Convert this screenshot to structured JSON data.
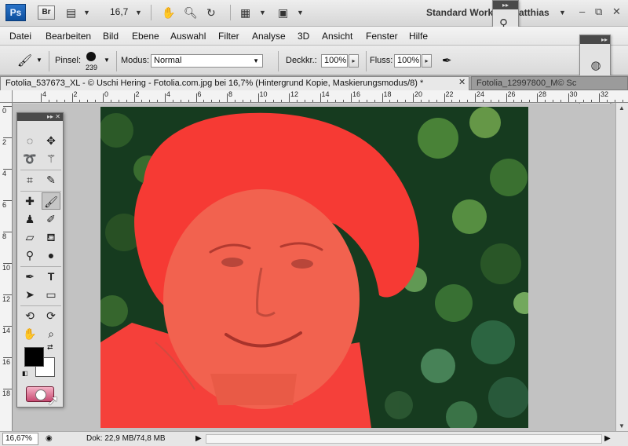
{
  "appbar": {
    "ps": "Ps",
    "br": "Br",
    "zoom": "16,7",
    "workspace": "Standard Work",
    "user": "atthias",
    "minimize": "–",
    "restore": "⧉",
    "close": "✕"
  },
  "menu": [
    "Datei",
    "Bearbeiten",
    "Bild",
    "Ebene",
    "Auswahl",
    "Filter",
    "Analyse",
    "3D",
    "Ansicht",
    "Fenster",
    "Hilfe"
  ],
  "options": {
    "brush_label": "Pinsel:",
    "brush_size": "239",
    "mode_label": "Modus:",
    "mode_value": "Normal",
    "opacity_label": "Deckkr.:",
    "opacity_value": "100%",
    "flow_label": "Fluss:",
    "flow_value": "100%"
  },
  "tabs": {
    "active": "Fotolia_537673_XL - © Uschi Hering - Fotolia.com.jpg bei 16,7% (Hintergrund Kopie, Maskierungsmodus/8) *",
    "close": "✕",
    "inactive": "Fotolia_12997800_M© Sc"
  },
  "ruler": {
    "h": [
      "4",
      "2",
      "0",
      "2",
      "4",
      "6",
      "8",
      "10",
      "12",
      "14",
      "16",
      "18",
      "20",
      "22",
      "24",
      "26",
      "28",
      "30",
      "32"
    ],
    "v": [
      "0",
      "2",
      "4",
      "6",
      "8",
      "10",
      "12",
      "14",
      "16",
      "18"
    ]
  },
  "status": {
    "zoom": "16,67%",
    "doc": "Dok: 22,9 MB/74,8 MB"
  },
  "colors": {
    "mask_overlay": "#ff3a3a",
    "foreground": "#000000",
    "background": "#ffffff"
  },
  "icons": [
    "move-tool-icon",
    "marquee-tool-icon",
    "lasso-tool-icon",
    "magic-wand-icon",
    "crop-tool-icon",
    "eyedropper-icon",
    "healing-brush-icon",
    "brush-tool-icon",
    "stamp-tool-icon",
    "history-brush-icon",
    "eraser-icon",
    "paint-bucket-icon",
    "dodge-tool-icon",
    "blur-tool-icon",
    "pen-tool-icon",
    "type-tool-icon",
    "path-select-icon",
    "shape-tool-icon",
    "rotate-3d-icon",
    "orbit-3d-icon",
    "hand-tool-icon",
    "zoom-tool-icon"
  ]
}
